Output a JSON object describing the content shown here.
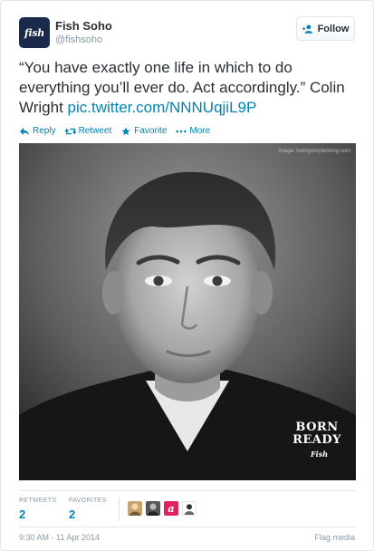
{
  "account": {
    "avatar_text": "fish",
    "name": "Fish Soho",
    "handle": "@fishsoho"
  },
  "follow_button": {
    "label": "Follow"
  },
  "tweet": {
    "text": "“You have exactly one life in which to do everything you’ll ever do. Act accordingly.” Colin Wright ",
    "link": "pic.twitter.com/NNNUqjiL9P"
  },
  "actions": {
    "reply": "Reply",
    "retweet": "Retweet",
    "favorite": "Favorite",
    "more": "More"
  },
  "media": {
    "credit": "Image: lovingsimpleliving.com",
    "overlay_line1": "BORN",
    "overlay_line2": "READY",
    "overlay_brand": "Fish",
    "icon": "portrait-photo"
  },
  "stats": {
    "retweets_label": "RETWEETS",
    "retweets_value": "2",
    "favorites_label": "FAVORITES",
    "favorites_value": "2",
    "favoriter_icons": [
      "person-avatar",
      "person-avatar",
      "letter-a-avatar",
      "gaming-avatar"
    ]
  },
  "footer": {
    "timestamp": "9:30 AM - 11 Apr 2014",
    "flag_label": "Flag media"
  },
  "colors": {
    "link": "#0084b4",
    "text": "#292f33",
    "muted": "#8899a6",
    "border": "#e1e8ed",
    "brand_avatar": "#1a2a4a"
  }
}
